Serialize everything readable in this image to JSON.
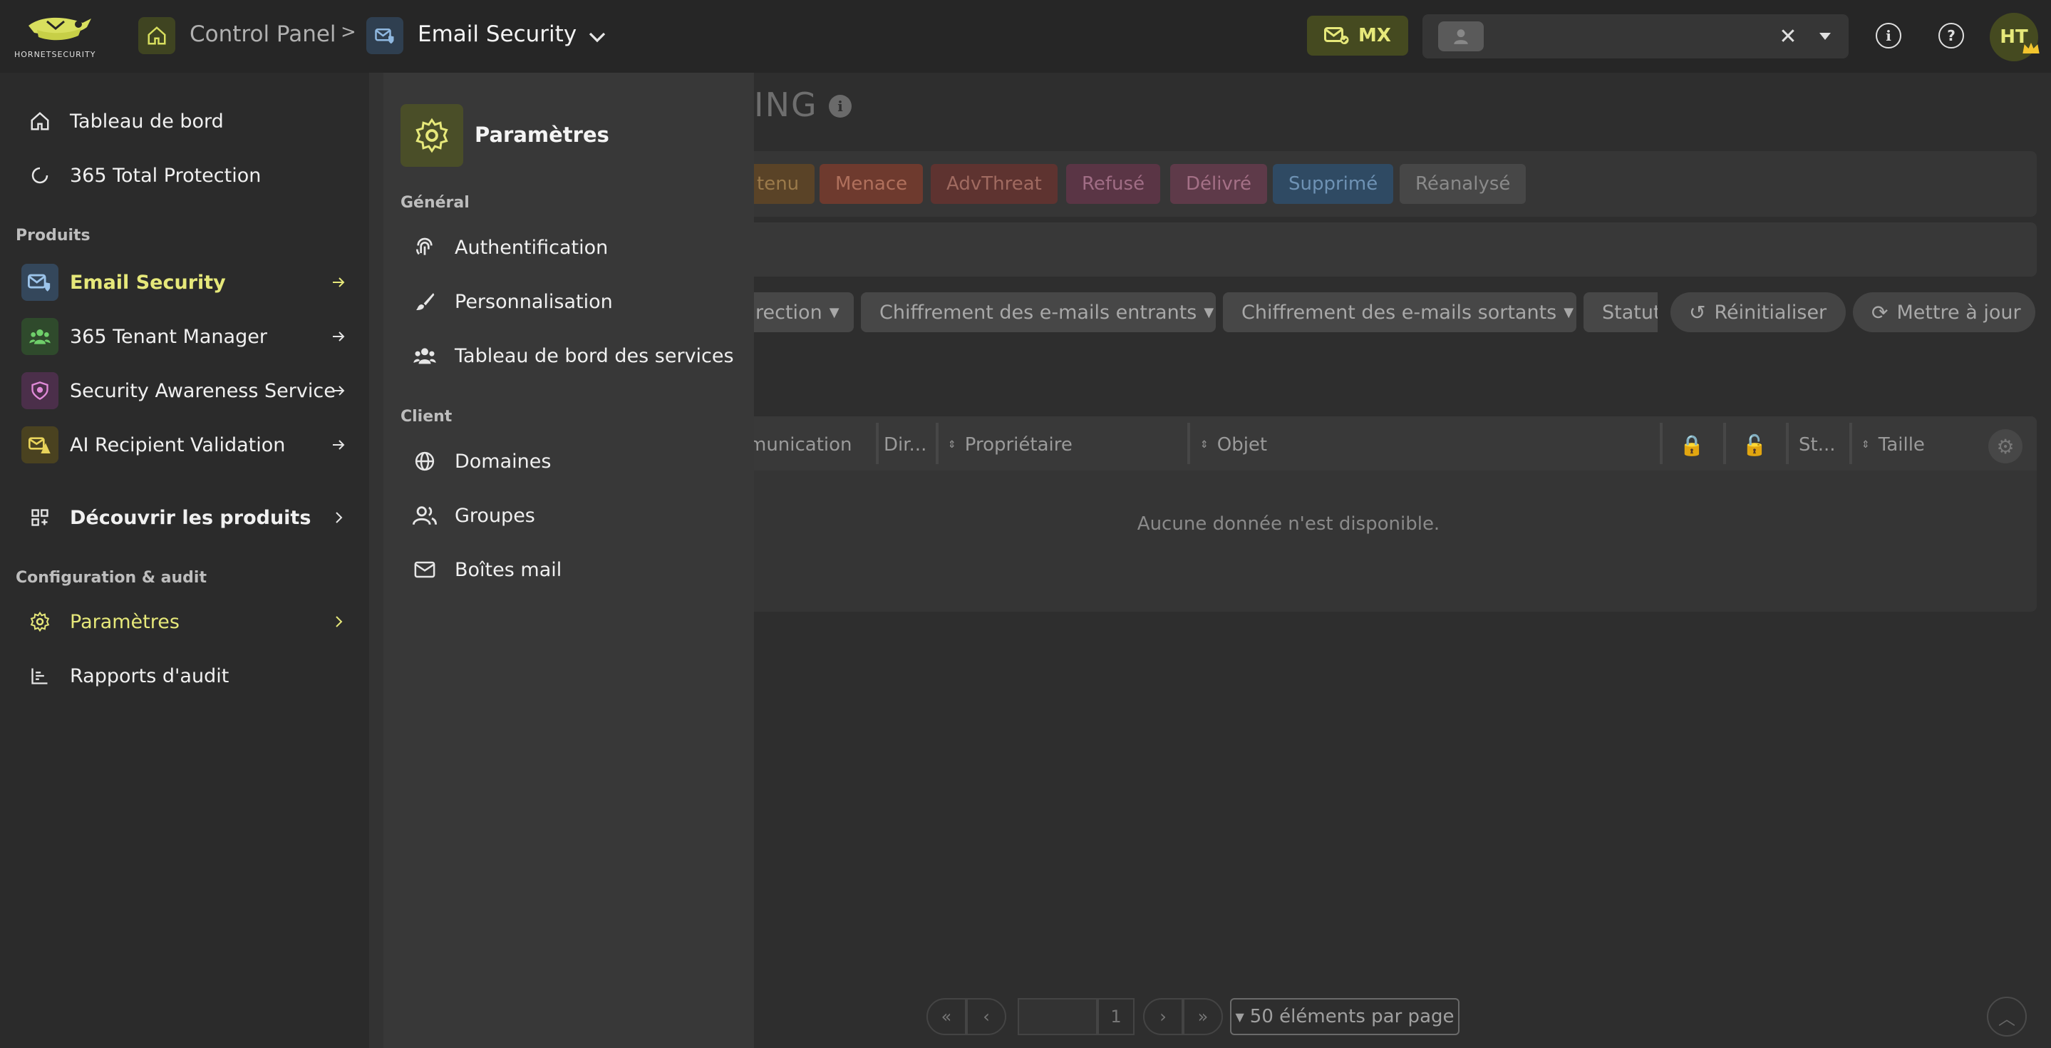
{
  "header": {
    "logo_text": "HORNETSECURITY",
    "breadcrumb_root": "Control Panel",
    "breadcrumb_sep": ">",
    "breadcrumb_current": "Email Security",
    "mx_badge": "MX",
    "avatar_initials": "HT"
  },
  "sidebar": {
    "top_items": [
      {
        "label": "Tableau de bord"
      },
      {
        "label": "365 Total Protection"
      }
    ],
    "products_heading": "Produits",
    "products": [
      {
        "label": "Email Security",
        "color": "#e6e87a",
        "active": true
      },
      {
        "label": "365 Tenant Manager"
      },
      {
        "label": "Security Awareness Service"
      },
      {
        "label": "AI Recipient Validation"
      }
    ],
    "discover_label": "Découvrir les produits",
    "config_heading": "Configuration & audit",
    "settings_label": "Paramètres",
    "audit_label": "Rapports d'audit"
  },
  "submenu": {
    "title": "Paramètres",
    "general_heading": "Général",
    "general_items": [
      {
        "label": "Authentification"
      },
      {
        "label": "Personnalisation"
      },
      {
        "label": "Tableau de bord des services"
      }
    ],
    "client_heading": "Client",
    "client_items": [
      {
        "label": "Domaines"
      },
      {
        "label": "Groupes"
      },
      {
        "label": "Boîtes mail"
      }
    ]
  },
  "background": {
    "page_title_fragment": "ING",
    "chips": [
      {
        "label": "tenu",
        "bg": "#5a4327",
        "fg": "#9b7a4a"
      },
      {
        "label": "Menace",
        "bg": "#6e3a2e",
        "fg": "#b0705c"
      },
      {
        "label": "AdvThreat",
        "bg": "#5e3330",
        "fg": "#a06a60"
      },
      {
        "label": "Refusé",
        "bg": "#5a3545",
        "fg": "#a06d85"
      },
      {
        "label": "Délivré",
        "bg": "#5e3a49",
        "fg": "#a47086"
      },
      {
        "label": "Supprimé",
        "bg": "#2f4a63",
        "fg": "#6e92b4"
      },
      {
        "label": "Réanalysé",
        "bg": "#474747",
        "fg": "#8a8a8a"
      }
    ],
    "filters": {
      "direction": "rection",
      "incoming": "Chiffrement des e-mails entrants",
      "outgoing": "Chiffrement des e-mails sortants",
      "status": "Statut",
      "reset": "Réinitialiser",
      "refresh": "Mettre à jour"
    },
    "columns": {
      "communication": "munication",
      "direction": "Dir...",
      "owner": "Propriétaire",
      "subject": "Objet",
      "status": "St...",
      "size": "Taille"
    },
    "empty_message": "Aucune donnée n'est disponible.",
    "pagination": {
      "page_number": "1",
      "per_page": "50 éléments par page"
    }
  }
}
